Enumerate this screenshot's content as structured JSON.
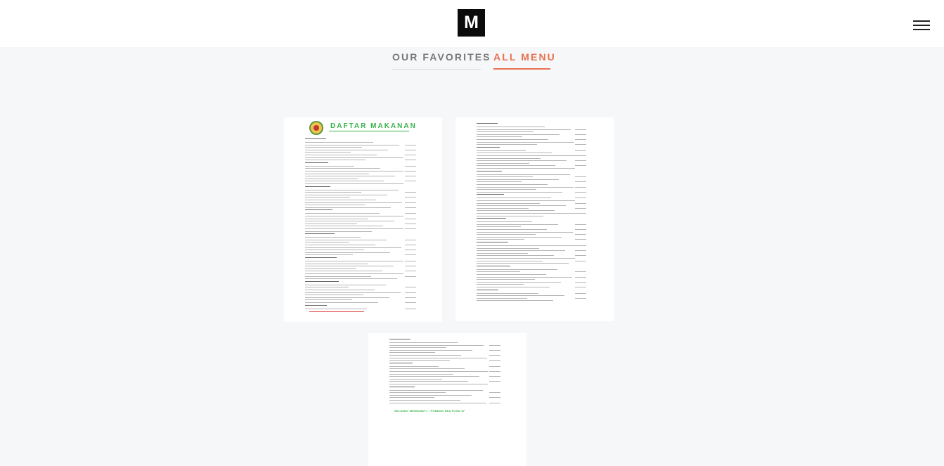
{
  "header": {
    "logo_text": "M",
    "menu_icon": "hamburger-menu-icon"
  },
  "tabs": [
    {
      "label": "OUR FAVORITES",
      "active": false
    },
    {
      "label": "ALL MENU",
      "active": true
    }
  ],
  "menu_pages": {
    "page1_title": "DAFTAR  MAKANAN",
    "page3_footer": "SELAMAT MENIKMATI :: PONDOK SEA FOOD 57"
  },
  "colors": {
    "accent": "#e8704f",
    "logo_bg": "#0b0b0b",
    "page_bg": "#f6f7f9",
    "menu_title_green": "#3ab24a"
  }
}
